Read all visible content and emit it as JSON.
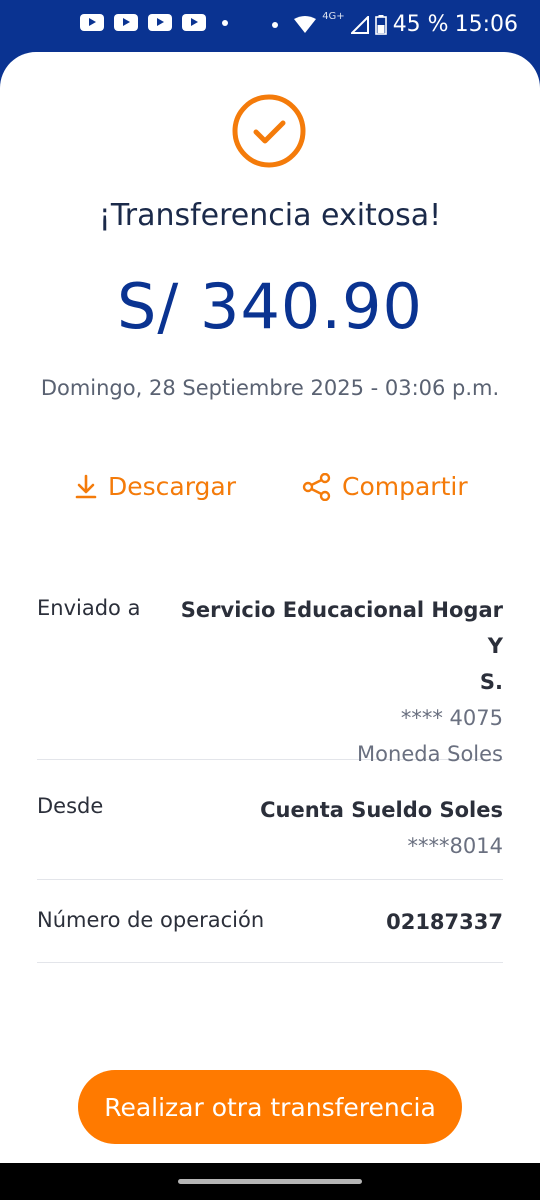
{
  "status_bar": {
    "network": "4G+",
    "battery": "45 %",
    "time": "15:06"
  },
  "icons": {
    "success": "check-circle-icon",
    "download": "download-icon",
    "share": "share-icon"
  },
  "colors": {
    "brand_blue": "#0a3391",
    "accent_orange": "#ff7a00"
  },
  "confirmation": {
    "title": "¡Transferencia exitosa!",
    "amount": "S/ 340.90",
    "datetime": "Domingo, 28 Septiembre 2025 - 03:06 p.m."
  },
  "actions": {
    "download_label": "Descargar",
    "share_label": "Compartir"
  },
  "details": {
    "sent_to": {
      "label": "Enviado a",
      "name_line1": "Servicio Educacional Hogar Y",
      "name_line2": "S.",
      "account": "**** 4075",
      "currency": "Moneda Soles"
    },
    "from": {
      "label": "Desde",
      "account_name": "Cuenta Sueldo Soles",
      "account_number": "****8014"
    },
    "operation": {
      "label": "Número de operación",
      "number": "02187337"
    }
  },
  "primary_button": {
    "label": "Realizar otra transferencia"
  }
}
